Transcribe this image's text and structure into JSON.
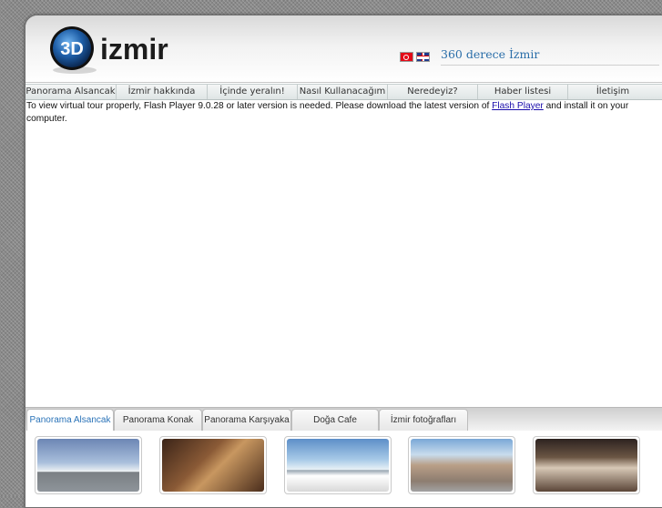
{
  "header": {
    "logo_prefix": "3D",
    "logo_word": "izmir",
    "site_title": "360 derece İzmir",
    "flags": [
      "turkish-flag-icon",
      "uk-flag-icon"
    ]
  },
  "nav": {
    "items": [
      {
        "label": "Panorama Alsancak"
      },
      {
        "label": "İzmir hakkında"
      },
      {
        "label": "İçinde yeralın!"
      },
      {
        "label": "Nasıl Kullanacağım"
      },
      {
        "label": "Neredeyiz?"
      },
      {
        "label": "Haber listesi"
      },
      {
        "label": "İletişim"
      }
    ]
  },
  "message": {
    "before": "To view virtual tour properly, Flash Player 9.0.28 or later version is needed. Please download the latest version of ",
    "link": "Flash Player",
    "after": " and install it on your computer."
  },
  "tabs": {
    "items": [
      {
        "label": "Panorama Alsancak"
      },
      {
        "label": "Panorama Konak"
      },
      {
        "label": "Panorama Karşıyaka"
      },
      {
        "label": "Doğa Cafe"
      },
      {
        "label": "İzmir fotoğrafları"
      }
    ],
    "active_index": 0
  },
  "thumbnails": [
    "alsancak-pier-thumbnail",
    "hotel-lobby-thumbnail",
    "konak-square-thumbnail",
    "street-view-thumbnail",
    "cafe-interior-thumbnail"
  ],
  "colors": {
    "accent": "#2a73b8",
    "site_title": "#2a6ea9",
    "link": "#1a0dab"
  }
}
